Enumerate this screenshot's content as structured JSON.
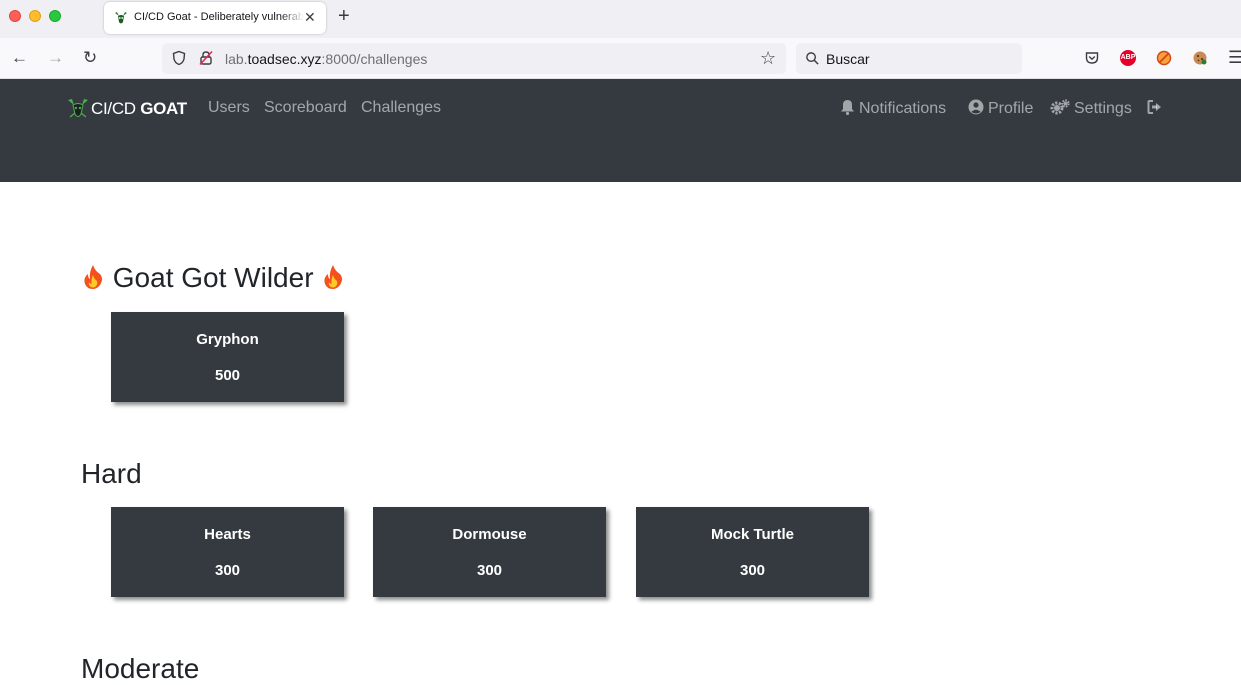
{
  "browser": {
    "tab_title": "CI/CD Goat - Deliberately vulnerable CI/CD environment",
    "url_prefix": "lab.",
    "url_host": "toadsec.xyz",
    "url_rest": ":8000/challenges",
    "search_placeholder": "Buscar",
    "extensions": [
      "pocket-icon",
      "adblock-plus-icon",
      "blocker-icon",
      "cookie-icon"
    ],
    "abp_label": "ABP"
  },
  "site": {
    "brand_light": "CI/CD ",
    "brand_bold": "GOAT",
    "nav_left": {
      "users": "Users",
      "scoreboard": "Scoreboard",
      "challenges": "Challenges"
    },
    "nav_right": {
      "notifications": "Notifications",
      "profile": "Profile",
      "settings": "Settings"
    }
  },
  "sections": [
    {
      "title": "Goat Got Wilder",
      "challenges": [
        {
          "name": "Gryphon",
          "points": "500"
        }
      ]
    },
    {
      "title": "Hard",
      "challenges": [
        {
          "name": "Hearts",
          "points": "300"
        },
        {
          "name": "Dormouse",
          "points": "300"
        },
        {
          "name": "Mock Turtle",
          "points": "300"
        }
      ]
    },
    {
      "title": "Moderate",
      "challenges": []
    }
  ],
  "colors": {
    "header_bg": "#343a40",
    "card_bg": "#343a40",
    "flame": "#f4511e"
  }
}
